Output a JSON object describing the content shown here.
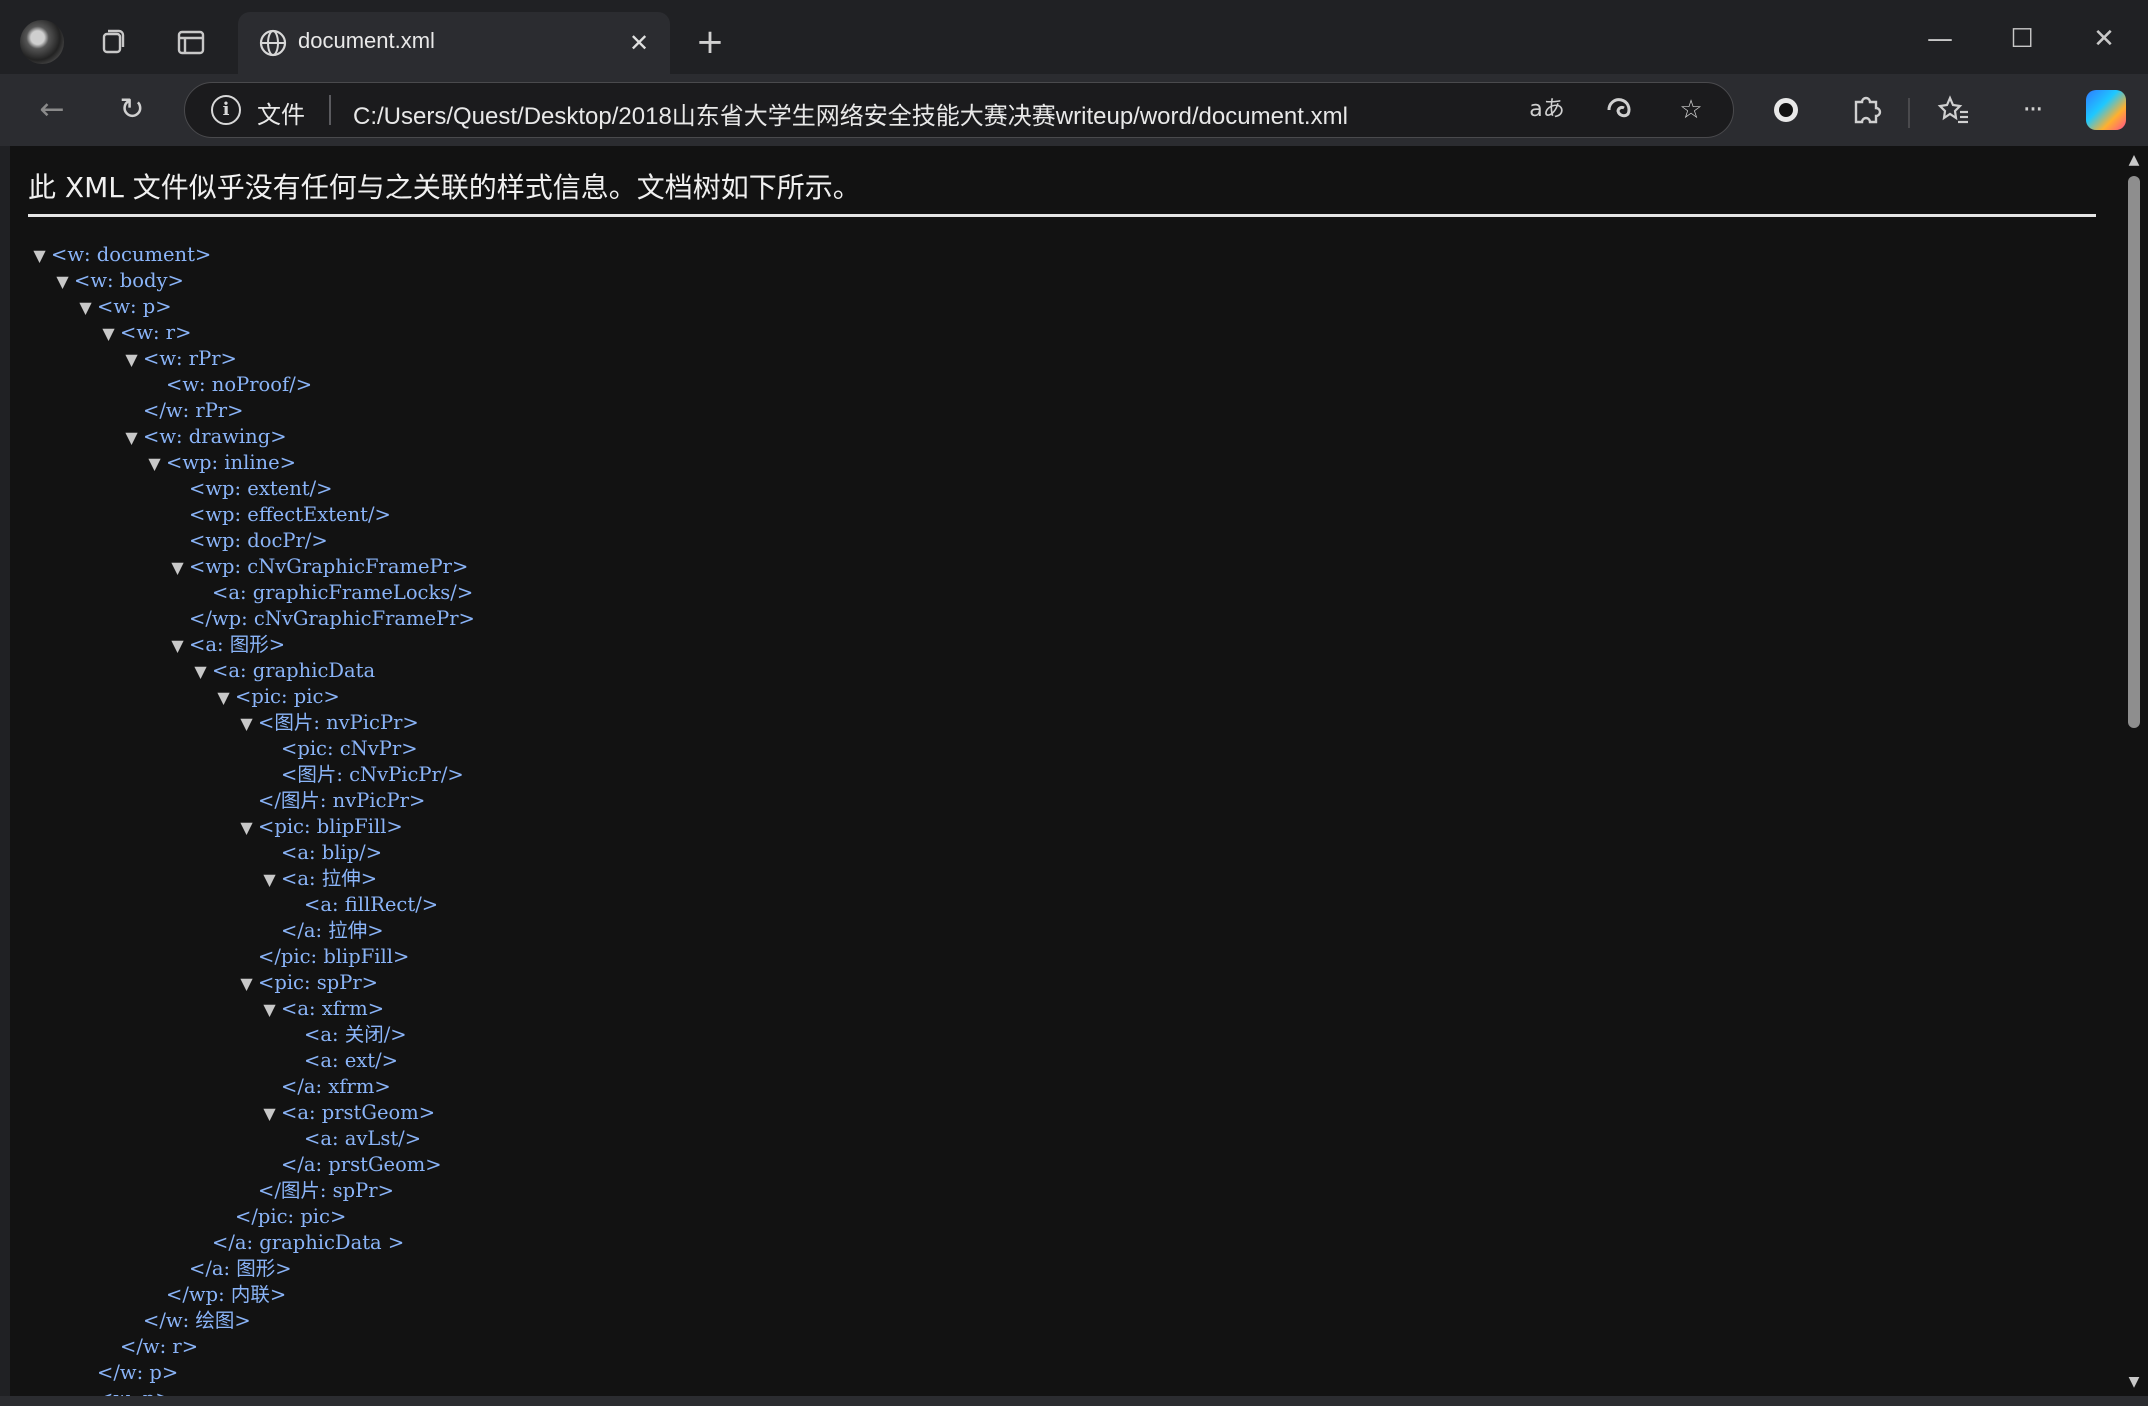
{
  "tabbar": {
    "workspaces_icon": "workspaces-icon",
    "vertical_tabs_icon": "vertical-tabs-icon",
    "tab": {
      "title": "document.xml",
      "icon": "globe-icon",
      "close_icon": "close-icon"
    },
    "new_tab_icon": "plus-icon",
    "window_controls": {
      "minimize": "minimize-icon",
      "maximize": "maximize-icon",
      "close": "close-icon"
    }
  },
  "toolbar": {
    "back_icon": "back-arrow-icon",
    "refresh_icon": "refresh-icon",
    "address": {
      "info_icon": "info-icon",
      "scheme_label": "文件",
      "url": "C:/Users/Quest/Desktop/2018山东省大学生网络安全技能大赛决赛writeup/word/document.xml",
      "translate_label": "aあ",
      "edge_icon": "edge-icon",
      "favorite_icon": "star-icon"
    },
    "record_icon": "record-icon",
    "extensions_icon": "puzzle-icon",
    "favorites_icon": "favorites-icon",
    "more_label": "···",
    "copilot_icon": "copilot-icon"
  },
  "content": {
    "notice": "此 XML 文件似乎没有任何与之关联的样式信息。文档树如下所示。",
    "tree": [
      {
        "indent": 0,
        "toggle": true,
        "text": "<w: document>"
      },
      {
        "indent": 1,
        "toggle": true,
        "text": "<w: body>"
      },
      {
        "indent": 2,
        "toggle": true,
        "text": "<w: p>"
      },
      {
        "indent": 3,
        "toggle": true,
        "text": "<w: r>"
      },
      {
        "indent": 4,
        "toggle": true,
        "text": "<w: rPr>"
      },
      {
        "indent": 5,
        "toggle": false,
        "text": "<w: noProof/>"
      },
      {
        "indent": 4,
        "toggle": false,
        "text": "</w: rPr>"
      },
      {
        "indent": 4,
        "toggle": true,
        "text": "<w: drawing>"
      },
      {
        "indent": 5,
        "toggle": true,
        "text": "<wp: inline>"
      },
      {
        "indent": 6,
        "toggle": false,
        "text": "<wp: extent/>"
      },
      {
        "indent": 6,
        "toggle": false,
        "text": "<wp: effectExtent/>"
      },
      {
        "indent": 6,
        "toggle": false,
        "text": "<wp: docPr/>"
      },
      {
        "indent": 6,
        "toggle": true,
        "text": "<wp: cNvGraphicFramePr>"
      },
      {
        "indent": 7,
        "toggle": false,
        "text": "<a: graphicFrameLocks/>"
      },
      {
        "indent": 6,
        "toggle": false,
        "text": "</wp: cNvGraphicFramePr>"
      },
      {
        "indent": 6,
        "toggle": true,
        "text": "<a: 图形>"
      },
      {
        "indent": 7,
        "toggle": true,
        "text": "<a: graphicData"
      },
      {
        "indent": 8,
        "toggle": true,
        "text": "<pic: pic>"
      },
      {
        "indent": 9,
        "toggle": true,
        "text": "<图片: nvPicPr>"
      },
      {
        "indent": 10,
        "toggle": false,
        "text": "<pic: cNvPr>"
      },
      {
        "indent": 10,
        "toggle": false,
        "text": "<图片: cNvPicPr/>"
      },
      {
        "indent": 9,
        "toggle": false,
        "text": "</图片: nvPicPr>"
      },
      {
        "indent": 9,
        "toggle": true,
        "text": "<pic: blipFill>"
      },
      {
        "indent": 10,
        "toggle": false,
        "text": "<a: blip/>"
      },
      {
        "indent": 10,
        "toggle": true,
        "text": "<a: 拉伸>"
      },
      {
        "indent": 11,
        "toggle": false,
        "text": "<a: fillRect/>"
      },
      {
        "indent": 10,
        "toggle": false,
        "text": "</a: 拉伸>"
      },
      {
        "indent": 9,
        "toggle": false,
        "text": "</pic: blipFill>"
      },
      {
        "indent": 9,
        "toggle": true,
        "text": "<pic: spPr>"
      },
      {
        "indent": 10,
        "toggle": true,
        "text": "<a: xfrm>"
      },
      {
        "indent": 11,
        "toggle": false,
        "text": "<a: 关闭/>"
      },
      {
        "indent": 11,
        "toggle": false,
        "text": "<a: ext/>"
      },
      {
        "indent": 10,
        "toggle": false,
        "text": "</a: xfrm>"
      },
      {
        "indent": 10,
        "toggle": true,
        "text": "<a: prstGeom>"
      },
      {
        "indent": 11,
        "toggle": false,
        "text": "<a: avLst/>"
      },
      {
        "indent": 10,
        "toggle": false,
        "text": "</a: prstGeom>"
      },
      {
        "indent": 9,
        "toggle": false,
        "text": "</图片: spPr>"
      },
      {
        "indent": 8,
        "toggle": false,
        "text": "</pic: pic>"
      },
      {
        "indent": 7,
        "toggle": false,
        "text": "</a: graphicData >"
      },
      {
        "indent": 6,
        "toggle": false,
        "text": "</a: 图形>"
      },
      {
        "indent": 5,
        "toggle": false,
        "text": "</wp: 内联>"
      },
      {
        "indent": 4,
        "toggle": false,
        "text": "</w: 绘图>"
      },
      {
        "indent": 3,
        "toggle": false,
        "text": "</w: r>"
      },
      {
        "indent": 2,
        "toggle": false,
        "text": "</w: p>"
      },
      {
        "indent": 2,
        "toggle": false,
        "text": "<w: p>"
      }
    ]
  },
  "scrollbar": {
    "up_icon": "scroll-up-icon",
    "down_icon": "scroll-down-icon"
  },
  "colors": {
    "tag": "#8ab4f8",
    "page_bg": "#121212",
    "chrome_bg": "#202124",
    "toolbar_bg": "#2b2c30"
  }
}
